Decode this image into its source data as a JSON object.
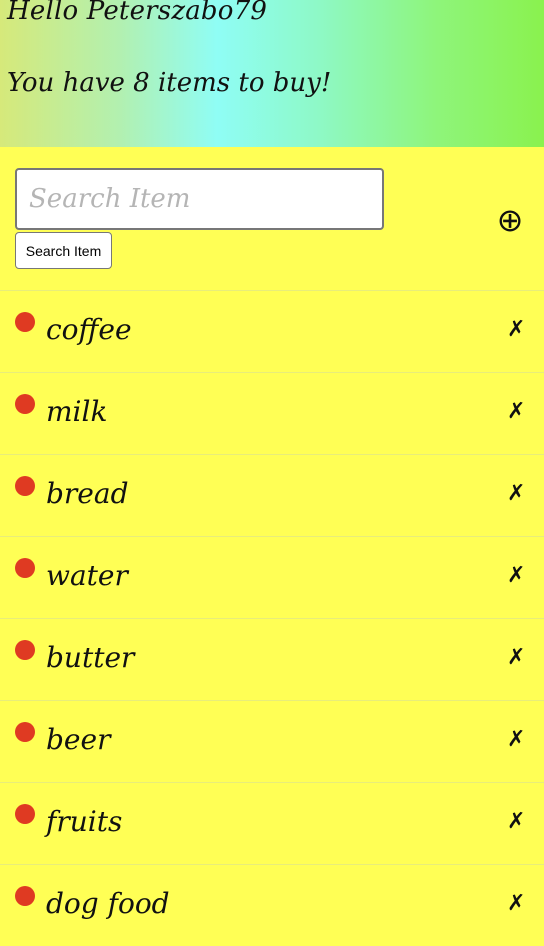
{
  "header": {
    "greeting": "Hello Peterszabo79",
    "items_line": "You have 8 items to buy!"
  },
  "search": {
    "placeholder": "Search Item",
    "value": "",
    "button_label": "Search Item",
    "add_symbol": "⊕"
  },
  "list": {
    "status_color": "#df3a22",
    "delete_symbol": "✗",
    "items": [
      {
        "name": "coffee"
      },
      {
        "name": "milk"
      },
      {
        "name": "bread"
      },
      {
        "name": "water"
      },
      {
        "name": "butter"
      },
      {
        "name": "beer"
      },
      {
        "name": "fruits"
      },
      {
        "name": "dog food"
      }
    ]
  }
}
